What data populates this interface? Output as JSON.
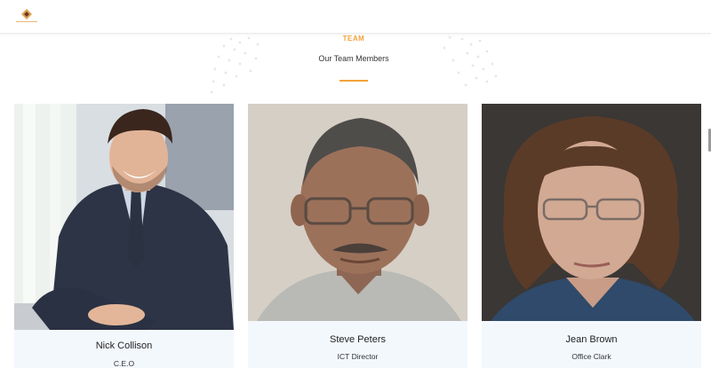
{
  "header": {
    "logo_icon": "diamond-logo-icon"
  },
  "section": {
    "tag": "TEAM",
    "title": "Our Team Members",
    "accent_color": "#f2a33a"
  },
  "team": [
    {
      "name": "Nick Collison",
      "role": "C.E.O"
    },
    {
      "name": "Steve Peters",
      "role": "ICT Director"
    },
    {
      "name": "Jean Brown",
      "role": "Office Clark"
    }
  ],
  "colors": {
    "card_info_bg": "#f3f8fd",
    "accent": "#f2a33a"
  }
}
